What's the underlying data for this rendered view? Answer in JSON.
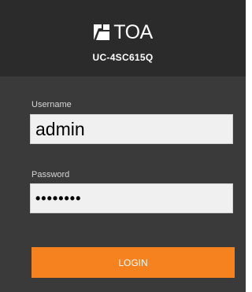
{
  "header": {
    "brand_name": "TOA",
    "model": "UC-4SC615Q",
    "logo_icon": "toa-logo-icon"
  },
  "login": {
    "username_label": "Username",
    "username_value": "admin",
    "password_label": "Password",
    "password_value": "••••••••",
    "login_button_label": "LOGIN"
  },
  "colors": {
    "panel_bg": "#3a3a3a",
    "header_bg": "#2b2b2b",
    "accent": "#f5821f"
  }
}
